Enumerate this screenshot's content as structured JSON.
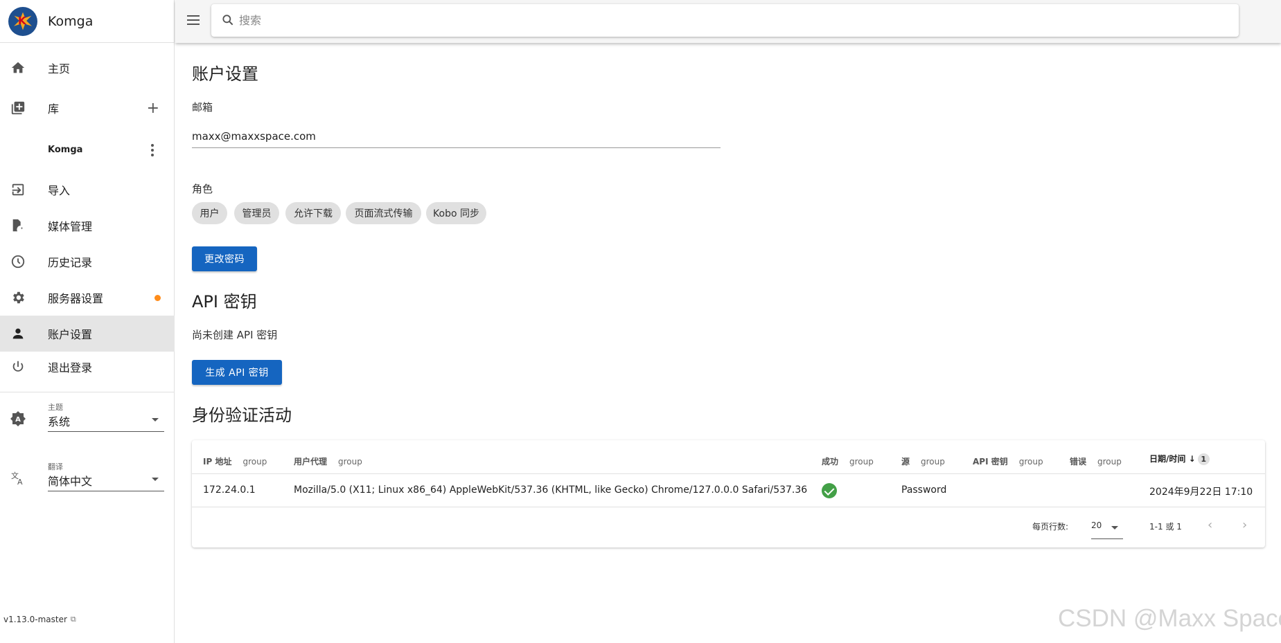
{
  "app": {
    "name": "Komga",
    "version": "v1.13.0-master"
  },
  "sidebar": {
    "items": [
      {
        "label": "主页",
        "icon": "home-icon"
      },
      {
        "label": "库",
        "icon": "library-icon"
      },
      {
        "label": "导入",
        "icon": "import-icon"
      },
      {
        "label": "媒体管理",
        "icon": "media-management-icon"
      },
      {
        "label": "历史记录",
        "icon": "history-icon"
      },
      {
        "label": "服务器设置",
        "icon": "gear-icon"
      },
      {
        "label": "账户设置",
        "icon": "account-icon"
      },
      {
        "label": "退出登录",
        "icon": "power-icon"
      }
    ],
    "library_add": "+",
    "library_entry": "Komga",
    "theme": {
      "caption": "主题",
      "value": "系统"
    },
    "language": {
      "caption": "翻译",
      "value": "简体中文"
    }
  },
  "search": {
    "placeholder": "搜索"
  },
  "account": {
    "title": "账户设置",
    "email_label": "邮箱",
    "email": "maxx@maxxspace.com",
    "roles_label": "角色",
    "roles": [
      "用户",
      "管理员",
      "允许下载",
      "页面流式传输",
      "Kobo 同步"
    ],
    "change_password": "更改密码"
  },
  "api_keys": {
    "title": "API 密钥",
    "empty": "尚未创建 API 密钥",
    "generate": "生成 API 密钥"
  },
  "auth_activity": {
    "title": "身份验证活动",
    "group_label": "group",
    "headers": [
      "IP 地址",
      "用户代理",
      "成功",
      "源",
      "API 密钥",
      "错误",
      "日期/时间"
    ],
    "sort_indicator": "↓",
    "sort_order": "1",
    "rows": [
      {
        "ip": "172.24.0.1",
        "user_agent": "Mozilla/5.0 (X11; Linux x86_64) AppleWebKit/537.36 (KHTML, like Gecko) Chrome/127.0.0.0 Safari/537.36",
        "success": true,
        "source": "Password",
        "api_key": "",
        "error": "",
        "datetime": "2024年9月22日 17:10"
      }
    ],
    "rows_per_page_label": "每页行数:",
    "rows_per_page": "20",
    "range": "1-1 或 1",
    "prev": "‹",
    "next": "›"
  },
  "watermark": "CSDN @Maxx Space",
  "colors": {
    "primary": "#1565c0",
    "success": "#43a047",
    "notification": "#ff8c1a"
  }
}
